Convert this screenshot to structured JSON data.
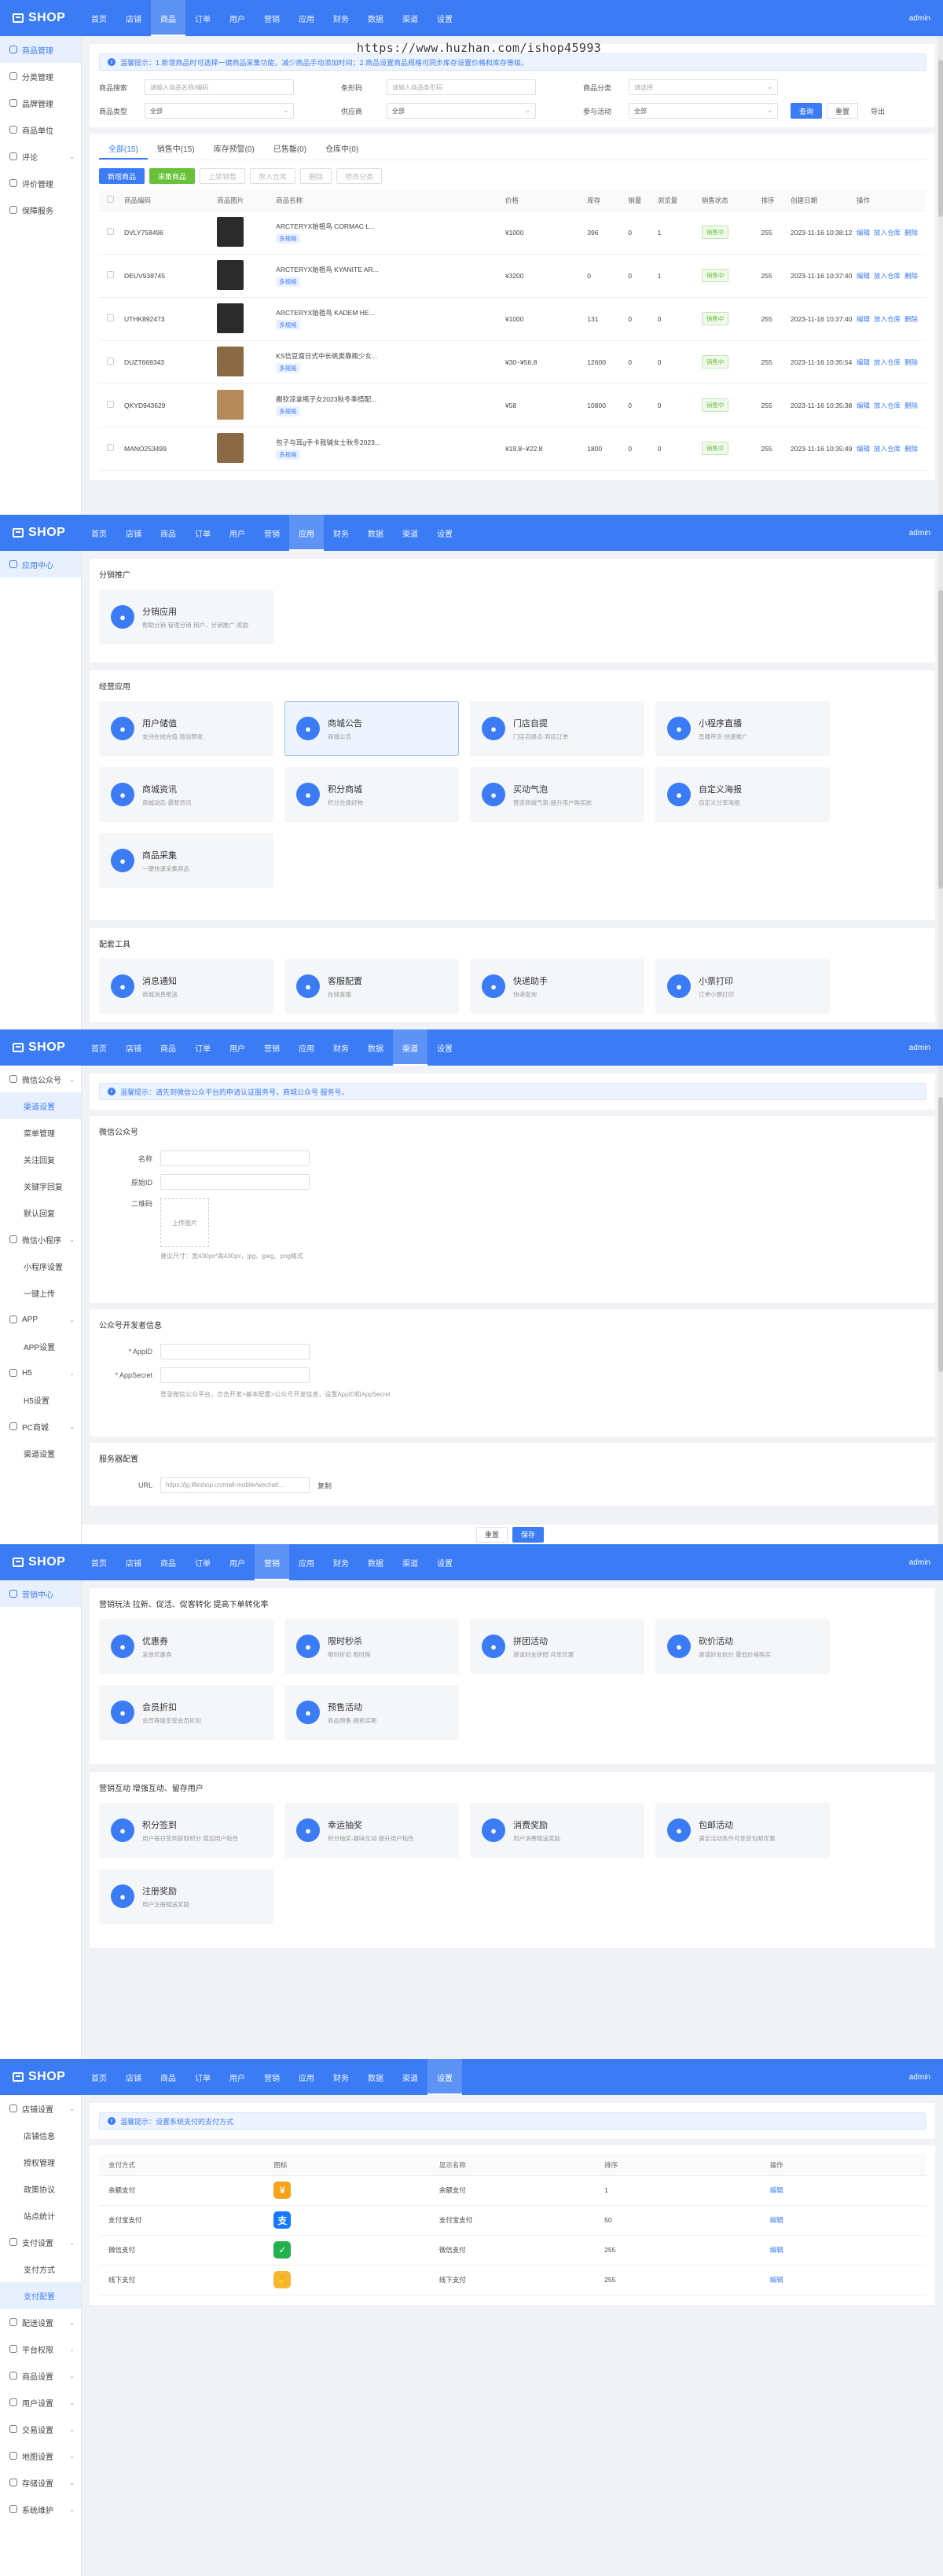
{
  "brand": "SHOP",
  "user": "admin",
  "nav": [
    "首页",
    "店铺",
    "商品",
    "订单",
    "用户",
    "营销",
    "应用",
    "财务",
    "数据",
    "渠道",
    "设置"
  ],
  "watermark": "https://www.huzhan.com/ishop45993",
  "goods": {
    "side": [
      "商品管理",
      "分类管理",
      "品牌管理",
      "商品单位",
      "评论",
      "评价管理",
      "保障服务"
    ],
    "notice": "温馨提示：1.新增商品时可选择一键商品采集功能，减少商品手动添加时间；2.商品设置商品规格可同步库存设置价格和库存等级。",
    "filters": {
      "name_label": "商品搜索",
      "name_ph": "请输入商品名称/编码",
      "code_label": "条形码",
      "code_ph": "请输入商品条形码",
      "cat_label": "商品分类",
      "cat_ph": "请选择",
      "type_label": "商品类型",
      "type_val": "全部",
      "supplier_label": "供应商",
      "supplier_val": "全部",
      "act_label": "参与活动",
      "act_val": "全部",
      "query": "查询",
      "reset": "重置",
      "export": "导出"
    },
    "tabs": [
      "全部(15)",
      "销售中(15)",
      "库存预警(0)",
      "已售罄(0)",
      "仓库中(0)"
    ],
    "actions": {
      "add": "新增商品",
      "collect": "采集商品",
      "b1": "上架销售",
      "b2": "放入仓库",
      "b3": "删除",
      "b4": "修改分类"
    },
    "headers": [
      "商品编码",
      "商品图片",
      "商品名称",
      "价格",
      "库存",
      "销量",
      "浏览量",
      "销售状态",
      "排序",
      "创建日期",
      "操作"
    ],
    "rows": [
      {
        "code": "DVLY758496",
        "name": "ARCTERYX始祖鸟 CORMAC L...",
        "price": "¥1000",
        "stock": "396",
        "sales": "0",
        "views": "1",
        "status": "销售中",
        "sort": "255",
        "date": "2023-11-16 10:38:12"
      },
      {
        "code": "DEUV938745",
        "name": "ARCTERYX始祖鸟 KYANITE AR...",
        "price": "¥3200",
        "stock": "0",
        "sales": "0",
        "views": "1",
        "status": "销售中",
        "sort": "255",
        "date": "2023-11-16 10:37:40"
      },
      {
        "code": "UTHK892473",
        "name": "ARCTERYX始祖鸟 KADEM HE...",
        "price": "¥1000",
        "stock": "131",
        "sales": "0",
        "views": "0",
        "status": "销售中",
        "sort": "255",
        "date": "2023-11-16 10:37:40"
      },
      {
        "code": "DUZT669343",
        "name": "KS信豆腐日式中长帆类靠瓶少女...",
        "price": "¥30~¥56.8",
        "stock": "12600",
        "sales": "0",
        "views": "0",
        "status": "销售中",
        "sort": "255",
        "date": "2023-11-16 10:35:54"
      },
      {
        "code": "QKYD943629",
        "name": "搬钦凉拿瓶子女2023秋冬季搭配...",
        "price": "¥58",
        "stock": "10800",
        "sales": "0",
        "views": "0",
        "status": "销售中",
        "sort": "255",
        "date": "2023-11-16 10:35:38"
      },
      {
        "code": "MANO253499",
        "name": "包子与耳g手卡我铺女士秋冬2023...",
        "price": "¥19.8~¥22.8",
        "stock": "1800",
        "sales": "0",
        "views": "0",
        "status": "销售中",
        "sort": "255",
        "date": "2023-11-16 10:35:49"
      }
    ],
    "multi_spec": "多规格",
    "ops": [
      "编辑",
      "放入仓库",
      "删除"
    ]
  },
  "apps": {
    "side": [
      "应用中心"
    ],
    "sec1": "分销推广",
    "dist": {
      "title": "分销应用",
      "desc": "帮助分销·管理分销·用户、分销推广·奖励"
    },
    "sec2": "经营应用",
    "items": [
      {
        "icon": "wallet-icon",
        "title": "用户储值",
        "desc": "支持在线充值 增加营收"
      },
      {
        "icon": "bell-icon",
        "title": "商城公告",
        "desc": "商城公告"
      },
      {
        "icon": "store-icon",
        "title": "门店自提",
        "desc": "门店自提点·到店订单"
      },
      {
        "icon": "live-icon",
        "title": "小程序直播",
        "desc": "直播带货·快速推广"
      },
      {
        "icon": "news-icon",
        "title": "商城资讯",
        "desc": "商城动态·最新资讯"
      },
      {
        "icon": "points-icon",
        "title": "积分商城",
        "desc": "积分兑换好物"
      },
      {
        "icon": "bubble-icon",
        "title": "买动气泡",
        "desc": "营造商城气氛·提升用户购买欲"
      },
      {
        "icon": "poster-icon",
        "title": "自定义海报",
        "desc": "自定义分享海报"
      },
      {
        "icon": "collect-icon",
        "title": "商品采集",
        "desc": "一键快速采集商品"
      }
    ],
    "sec3": "配套工具",
    "tools": [
      {
        "icon": "message-icon",
        "title": "消息通知",
        "desc": "商城消息推送"
      },
      {
        "icon": "service-icon",
        "title": "客服配置",
        "desc": "在线客服"
      },
      {
        "icon": "express-icon",
        "title": "快递助手",
        "desc": "快递查询"
      },
      {
        "icon": "print-icon",
        "title": "小票打印",
        "desc": "订单小票打印"
      }
    ]
  },
  "channel": {
    "side": [
      {
        "t": "微信公众号",
        "g": true
      },
      {
        "t": "渠道设置",
        "on": true
      },
      {
        "t": "菜单管理"
      },
      {
        "t": "关注回复"
      },
      {
        "t": "关键字回复"
      },
      {
        "t": "默认回复"
      },
      {
        "t": "微信小程序",
        "g": true
      },
      {
        "t": "小程序设置"
      },
      {
        "t": "一键上传"
      },
      {
        "t": "APP",
        "g": true
      },
      {
        "t": "APP设置"
      },
      {
        "t": "H5",
        "g": true
      },
      {
        "t": "H5设置"
      },
      {
        "t": "PC商城",
        "g": true
      },
      {
        "t": "渠道设置"
      }
    ],
    "notice": "温馨提示：请先到微信公众平台的申请认证服务号，商城公众号 服务号。",
    "sec1": "微信公众号",
    "name": "名称",
    "origin": "原始ID",
    "qrcode": "二维码",
    "upload": "上传图片",
    "hint1": "建议尺寸：宽430px*高430px，jpg、jpeg、png格式",
    "sec2": "公众号开发者信息",
    "appid": "* AppID",
    "secret": "* AppSecret",
    "hint2": "登录微信公众平台，点击开发>基本配置>公众号开发信息，设置AppID和AppSecret",
    "sec3": "服务器配置",
    "url_label": "URL",
    "url_val": "https://jg.lifeshop.cn/mall-mobile/wechat/...",
    "copy": "复制",
    "reset": "重置",
    "save": "保存"
  },
  "marketing": {
    "side": [
      "营销中心"
    ],
    "sec1": "营销玩法 拉新、促活、促客转化 提高下单转化率",
    "items1": [
      {
        "icon": "coupon-icon",
        "title": "优惠券",
        "desc": "发放优惠券"
      },
      {
        "icon": "clock-icon",
        "title": "限时秒杀",
        "desc": "限时折扣 限时购"
      },
      {
        "icon": "group-icon",
        "title": "拼团活动",
        "desc": "邀请好友拼团 共享优惠"
      },
      {
        "icon": "bargain-icon",
        "title": "砍价活动",
        "desc": "邀请好友砍价 最低价格购买"
      },
      {
        "icon": "vip-icon",
        "title": "会员折扣",
        "desc": "会员等级享受会员折扣"
      },
      {
        "icon": "presale-icon",
        "title": "预售活动",
        "desc": "商品预售·提前买断"
      }
    ],
    "sec2": "营销互动 增强互动、留存用户",
    "items2": [
      {
        "icon": "calendar-icon",
        "title": "积分签到",
        "desc": "用户每日签到获取积分 增加用户粘性"
      },
      {
        "icon": "wheel-icon",
        "title": "幸运抽奖",
        "desc": "积分抽奖·趣味互动 提升用户粘性"
      },
      {
        "icon": "reward-icon",
        "title": "消费奖励",
        "desc": "用户消费赠送奖励"
      },
      {
        "icon": "gift-icon",
        "title": "包邮活动",
        "desc": "满足活动条件可享受包邮优惠"
      },
      {
        "icon": "register-icon",
        "title": "注册奖励",
        "desc": "用户注册赠送奖励"
      }
    ]
  },
  "settings": {
    "side": [
      {
        "t": "店铺设置",
        "g": true
      },
      {
        "t": "店铺信息"
      },
      {
        "t": "授权管理"
      },
      {
        "t": "政策协议"
      },
      {
        "t": "站点统计"
      },
      {
        "t": "支付设置",
        "g": true
      },
      {
        "t": "支付方式"
      },
      {
        "t": "支付配置",
        "on": true
      },
      {
        "t": "配送设置",
        "g": true
      },
      {
        "t": "平台权限",
        "g": true
      },
      {
        "t": "商品设置",
        "g": true
      },
      {
        "t": "用户设置",
        "g": true
      },
      {
        "t": "交易设置",
        "g": true
      },
      {
        "t": "地图设置",
        "g": true
      },
      {
        "t": "存储设置",
        "g": true
      },
      {
        "t": "系统维护",
        "g": true
      }
    ],
    "notice": "温馨提示：设置系统支付的支付方式",
    "headers": [
      "支付方式",
      "图标",
      "显示名称",
      "排序",
      "操作"
    ],
    "rows": [
      {
        "name": "余额支付",
        "icon": "balance-icon",
        "color": "#f7a21b",
        "glyph": "¥",
        "display": "余额支付",
        "sort": "1",
        "op": "编辑"
      },
      {
        "name": "支付宝支付",
        "icon": "alipay-icon",
        "color": "#1677ff",
        "glyph": "支",
        "display": "支付宝支付",
        "sort": "50",
        "op": "编辑"
      },
      {
        "name": "微信支付",
        "icon": "wechat-pay-icon",
        "color": "#22b14c",
        "glyph": "✓",
        "display": "微信支付",
        "sort": "255",
        "op": "编辑"
      },
      {
        "name": "线下支付",
        "icon": "offline-pay-icon",
        "color": "#f5b731",
        "glyph": "✋",
        "display": "线下支付",
        "sort": "255",
        "op": "编辑"
      }
    ]
  },
  "colors": {
    "primary": "#3b7cf5",
    "success": "#67c23a"
  }
}
